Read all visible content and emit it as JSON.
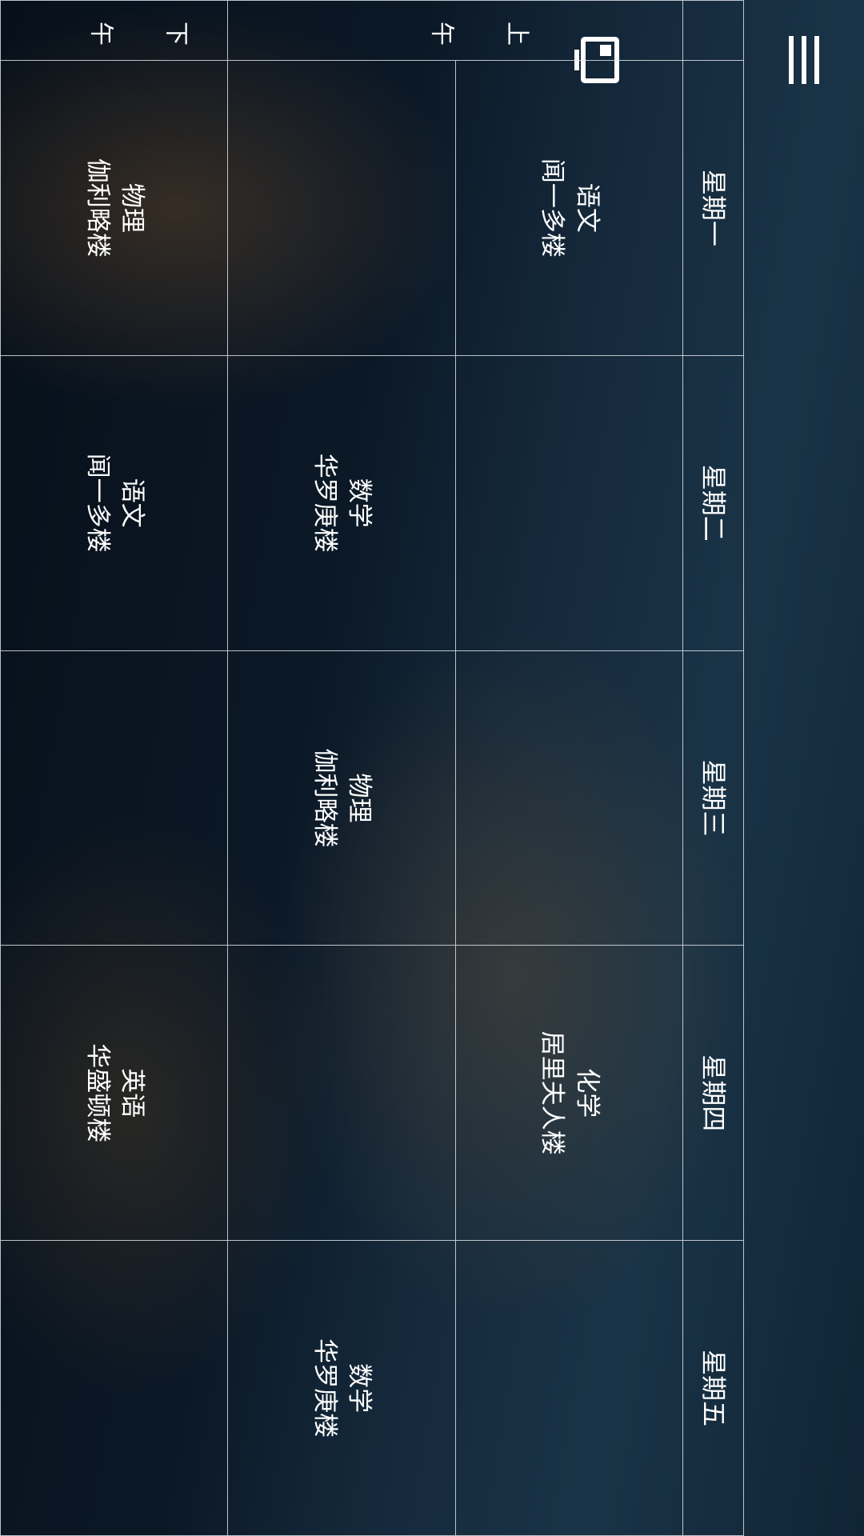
{
  "toolbar": {
    "menu_icon": "menu-icon",
    "window_icon": "window-icon"
  },
  "schedule": {
    "days": [
      "星期一",
      "星期二",
      "星期三",
      "星期四",
      "星期五"
    ],
    "periods": [
      "上午",
      "下午"
    ],
    "courses": {
      "morning": [
        {
          "name": "语文",
          "room": "闻一多楼"
        },
        {
          "name": "",
          "room": ""
        },
        {
          "name": "",
          "room": ""
        },
        {
          "name": "化学",
          "room": "居里夫人楼"
        },
        {
          "name": "",
          "room": ""
        }
      ],
      "afternoon": [
        {
          "name": "",
          "room": ""
        },
        {
          "name": "数学",
          "room": "华罗庚楼"
        },
        {
          "name": "物理",
          "room": "伽利略楼"
        },
        {
          "name": "",
          "room": ""
        },
        {
          "name": "数学",
          "room": "华罗庚楼"
        }
      ],
      "evening": [
        {
          "name": "物理",
          "room": "伽利略楼"
        },
        {
          "name": "语文",
          "room": "闻一多楼"
        },
        {
          "name": "",
          "room": ""
        },
        {
          "name": "英语",
          "room": "华盛顿楼"
        },
        {
          "name": "",
          "room": ""
        }
      ]
    }
  }
}
